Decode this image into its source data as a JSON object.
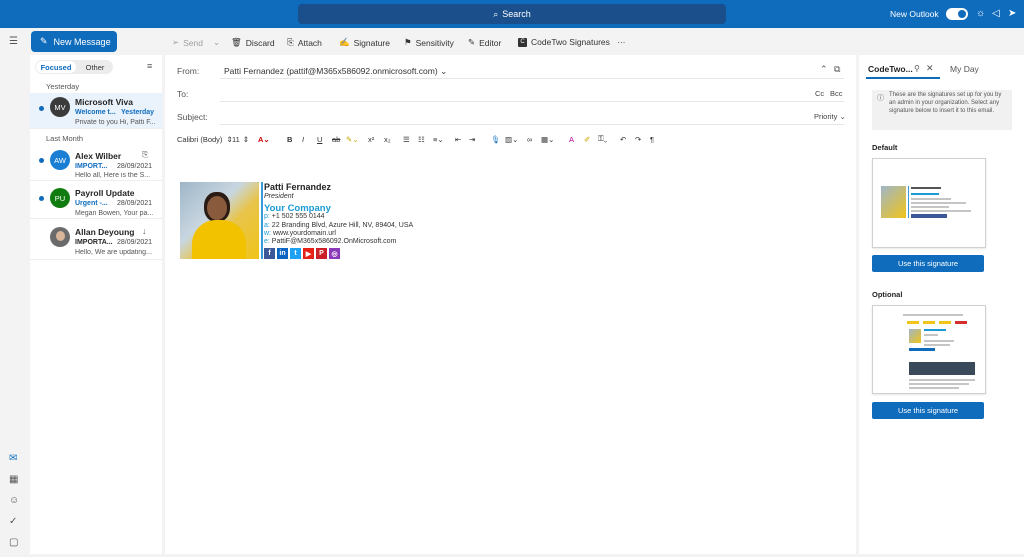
{
  "topbar": {
    "search_label": "Search",
    "new_outlook_label": "New Outlook"
  },
  "toolbar": {
    "new_message": "New Message",
    "send": "Send",
    "discard": "Discard",
    "attach": "Attach",
    "signature": "Signature",
    "sensitivity": "Sensitivity",
    "editor": "Editor",
    "codetwo": "CodeTwo Signatures",
    "more": "···"
  },
  "list": {
    "tab_focused": "Focused",
    "tab_other": "Other",
    "group_yesterday": "Yesterday",
    "group_last_month": "Last Month",
    "items": [
      {
        "initials": "MV",
        "sender": "Microsoft Viva",
        "subject": "Welcome t...",
        "date": "Yesterday",
        "preview": "Private to you Hi, Patti F...",
        "color": "#3b3b3b"
      },
      {
        "initials": "AW",
        "sender": "Alex Wilber",
        "subject": "IMPORT...",
        "date": "28/09/2021",
        "preview": "Hello all, Here is the S...",
        "color": "#1a7fd4"
      },
      {
        "initials": "PU",
        "sender": "Payroll Update",
        "subject": "Urgent -...",
        "date": "28/09/2021",
        "preview": "Megan Bowen, Your pa...",
        "color": "#107c10"
      },
      {
        "initials": "",
        "sender": "Allan Deyoung",
        "subject": "IMPORTA...",
        "date": "28/09/2021",
        "preview": "Hello, We are updating...",
        "color": "#6b6b6b"
      }
    ]
  },
  "compose": {
    "from_label": "From:",
    "from_value": "Patti Fernandez (pattif@M365x586092.onmicrosoft.com)",
    "to_label": "To:",
    "cc": "Cc",
    "bcc": "Bcc",
    "subject_label": "Subject:",
    "priority": "Priority",
    "font_name": "Calibri (Body)",
    "font_size": "11"
  },
  "signature": {
    "name": "Patti Fernandez",
    "title": "President",
    "company": "Your Company",
    "phone_prefix": "p:",
    "phone": "+1 502 555 0144",
    "addr_prefix": "a:",
    "address": "22 Branding Blvd, Azure Hill, NV, 89404, USA",
    "web_prefix": "w:",
    "web": "www.yourdomain.url",
    "email_prefix": "e:",
    "email": "PattiF@M365x586092.OnMicrosoft.com",
    "social": [
      {
        "glyph": "f",
        "color": "#3b5998"
      },
      {
        "glyph": "in",
        "color": "#0a66c2"
      },
      {
        "glyph": "t",
        "color": "#1da1f2"
      },
      {
        "glyph": "▶",
        "color": "#e62117"
      },
      {
        "glyph": "P",
        "color": "#cb2027"
      },
      {
        "glyph": "◎",
        "color": "#8a3ab9"
      }
    ]
  },
  "panel": {
    "tab_active": "CodeTwo...",
    "tab_other": "My Day",
    "info": "These are the signatures set up for you by an admin in your organization. Select any signature below to insert it to this email.",
    "default_heading": "Default",
    "optional_heading": "Optional",
    "use_button": "Use this signature"
  }
}
